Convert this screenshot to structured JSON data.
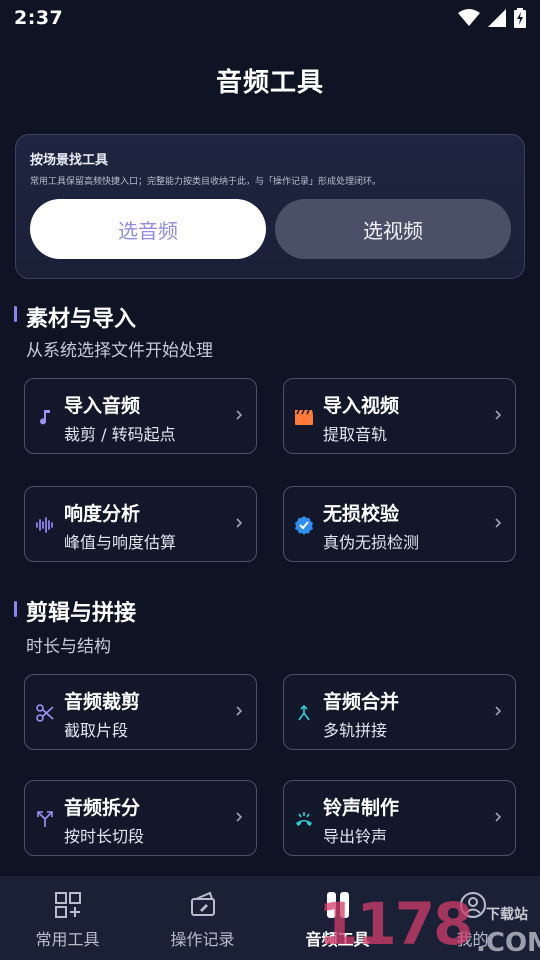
{
  "status": {
    "time": "2:37"
  },
  "header": {
    "title": "音频工具"
  },
  "scene": {
    "title": "按场景找工具",
    "desc": "常用工具保留高频快捷入口；完整能力按类目收纳于此，与「操作记录」形成处理闭环。",
    "btn_audio": "选音频",
    "btn_video": "选视频"
  },
  "sections": [
    {
      "title": "素材与导入",
      "subtitle": "从系统选择文件开始处理",
      "tools": [
        {
          "name": "导入音频",
          "desc": "裁剪 / 转码起点",
          "icon": "music-note-icon"
        },
        {
          "name": "导入视频",
          "desc": "提取音轨",
          "icon": "clapperboard-icon"
        },
        {
          "name": "响度分析",
          "desc": "峰值与响度估算",
          "icon": "waveform-icon"
        },
        {
          "name": "无损校验",
          "desc": "真伪无损检测",
          "icon": "verified-badge-icon"
        }
      ]
    },
    {
      "title": "剪辑与拼接",
      "subtitle": "时长与结构",
      "tools": [
        {
          "name": "音频裁剪",
          "desc": "截取片段",
          "icon": "scissors-icon"
        },
        {
          "name": "音频合并",
          "desc": "多轨拼接",
          "icon": "merge-icon"
        },
        {
          "name": "音频拆分",
          "desc": "按时长切段",
          "icon": "split-icon"
        },
        {
          "name": "铃声制作",
          "desc": "导出铃声",
          "icon": "ringtone-icon"
        }
      ]
    }
  ],
  "nav": [
    {
      "label": "常用工具",
      "icon": "grid-plus-icon",
      "active": false
    },
    {
      "label": "操作记录",
      "icon": "history-icon",
      "active": false
    },
    {
      "label": "音频工具",
      "icon": "audio-tools-icon",
      "active": true
    },
    {
      "label": "我的",
      "icon": "profile-icon",
      "active": false
    }
  ],
  "watermark": {
    "text": "1178",
    "suffix": ".COM",
    "badge": "下载站"
  },
  "colors": {
    "accent": "#8a86f0",
    "background": "#0f1424",
    "card_border": "#4a5168"
  }
}
